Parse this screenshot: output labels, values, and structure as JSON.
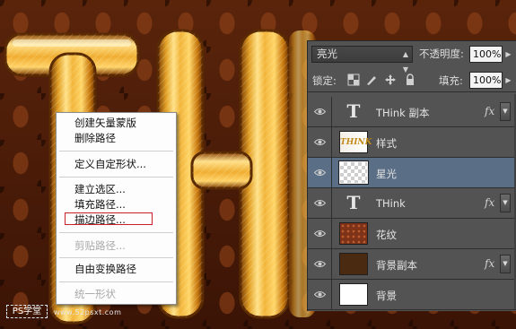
{
  "canvas": {
    "letters": [
      "T",
      "H"
    ],
    "watermark": {
      "badge": "PS学堂",
      "url": "www.52psxt.com"
    }
  },
  "context_menu": {
    "items": [
      {
        "label": "创建矢量蒙版",
        "enabled": true
      },
      {
        "label": "删除路径",
        "enabled": true
      },
      {
        "label": "定义自定形状...",
        "enabled": true
      },
      {
        "label": "建立选区...",
        "enabled": true
      },
      {
        "label": "填充路径...",
        "enabled": true
      },
      {
        "label": "描边路径...",
        "enabled": true,
        "highlighted": true
      },
      {
        "label": "剪贴路径...",
        "enabled": false
      },
      {
        "label": "自由变换路径",
        "enabled": true
      },
      {
        "label": "统一形状",
        "enabled": false
      }
    ],
    "highlight_color": "#c8202a"
  },
  "layers_panel": {
    "blend_mode": "亮光",
    "opacity_label": "不透明度:",
    "opacity_value": "100%",
    "lock_label": "锁定:",
    "lock_icons": [
      "lock-transparent-pixels-icon",
      "lock-image-pixels-icon",
      "lock-position-icon",
      "lock-all-icon"
    ],
    "fill_label": "填充:",
    "fill_value": "100%",
    "layers": [
      {
        "name": "THink 副本",
        "thumb": "type",
        "thumb_text": "T",
        "fx": true,
        "selected": false
      },
      {
        "name": "样式",
        "thumb": "style",
        "thumb_text": "THINK",
        "fx": false,
        "selected": false
      },
      {
        "name": "星光",
        "thumb": "transparent",
        "fx": false,
        "selected": true
      },
      {
        "name": "THink",
        "thumb": "type",
        "thumb_text": "T",
        "fx": true,
        "selected": false
      },
      {
        "name": "花纹",
        "thumb": "pattern",
        "fx": false,
        "selected": false
      },
      {
        "name": "背景副本",
        "thumb": "brown",
        "fx": true,
        "selected": false
      },
      {
        "name": "背景",
        "thumb": "white",
        "fx": false,
        "selected": false
      }
    ],
    "fx_symbol": "fx",
    "selected_color": "#5a6e85"
  }
}
